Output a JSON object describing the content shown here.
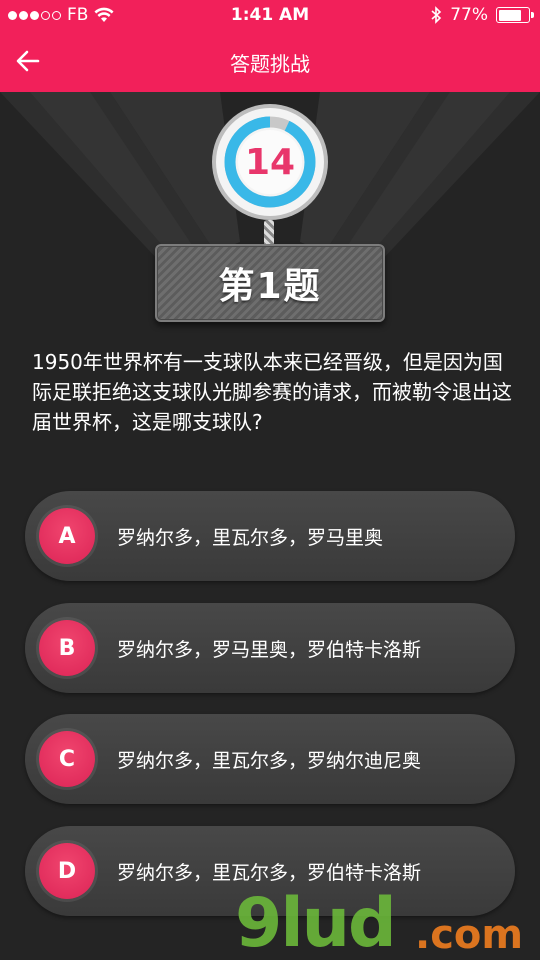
{
  "status_bar": {
    "carrier": "FB",
    "time": "1:41 AM",
    "battery_percent": "77%",
    "battery_level": 0.77,
    "signal_bars_filled": 3,
    "signal_bars_total": 5
  },
  "nav": {
    "title": "答题挑战"
  },
  "timer": {
    "value": "14",
    "progress": 0.93,
    "ring_color": "#39b8e8",
    "track_color": "#c8c8c8"
  },
  "question_label": "第1题",
  "question_text": "1950年世界杯有一支球队本来已经晋级，但是因为国际足联拒绝这支球队光脚参赛的请求，而被勒令退出这届世界杯，这是哪支球队?",
  "options": [
    {
      "letter": "A",
      "text": "罗纳尔多，里瓦尔多，罗马里奥"
    },
    {
      "letter": "B",
      "text": "罗纳尔多，罗马里奥，罗伯特卡洛斯"
    },
    {
      "letter": "C",
      "text": "罗纳尔多，里瓦尔多，罗纳尔迪尼奥"
    },
    {
      "letter": "D",
      "text": "罗纳尔多，里瓦尔多，罗伯特卡洛斯"
    }
  ],
  "watermark": {
    "main": "9lud",
    "suffix": ".com"
  },
  "colors": {
    "brand": "#f2205a",
    "background": "#242424",
    "option_bg": "#424242",
    "badge": "#e8305f"
  }
}
